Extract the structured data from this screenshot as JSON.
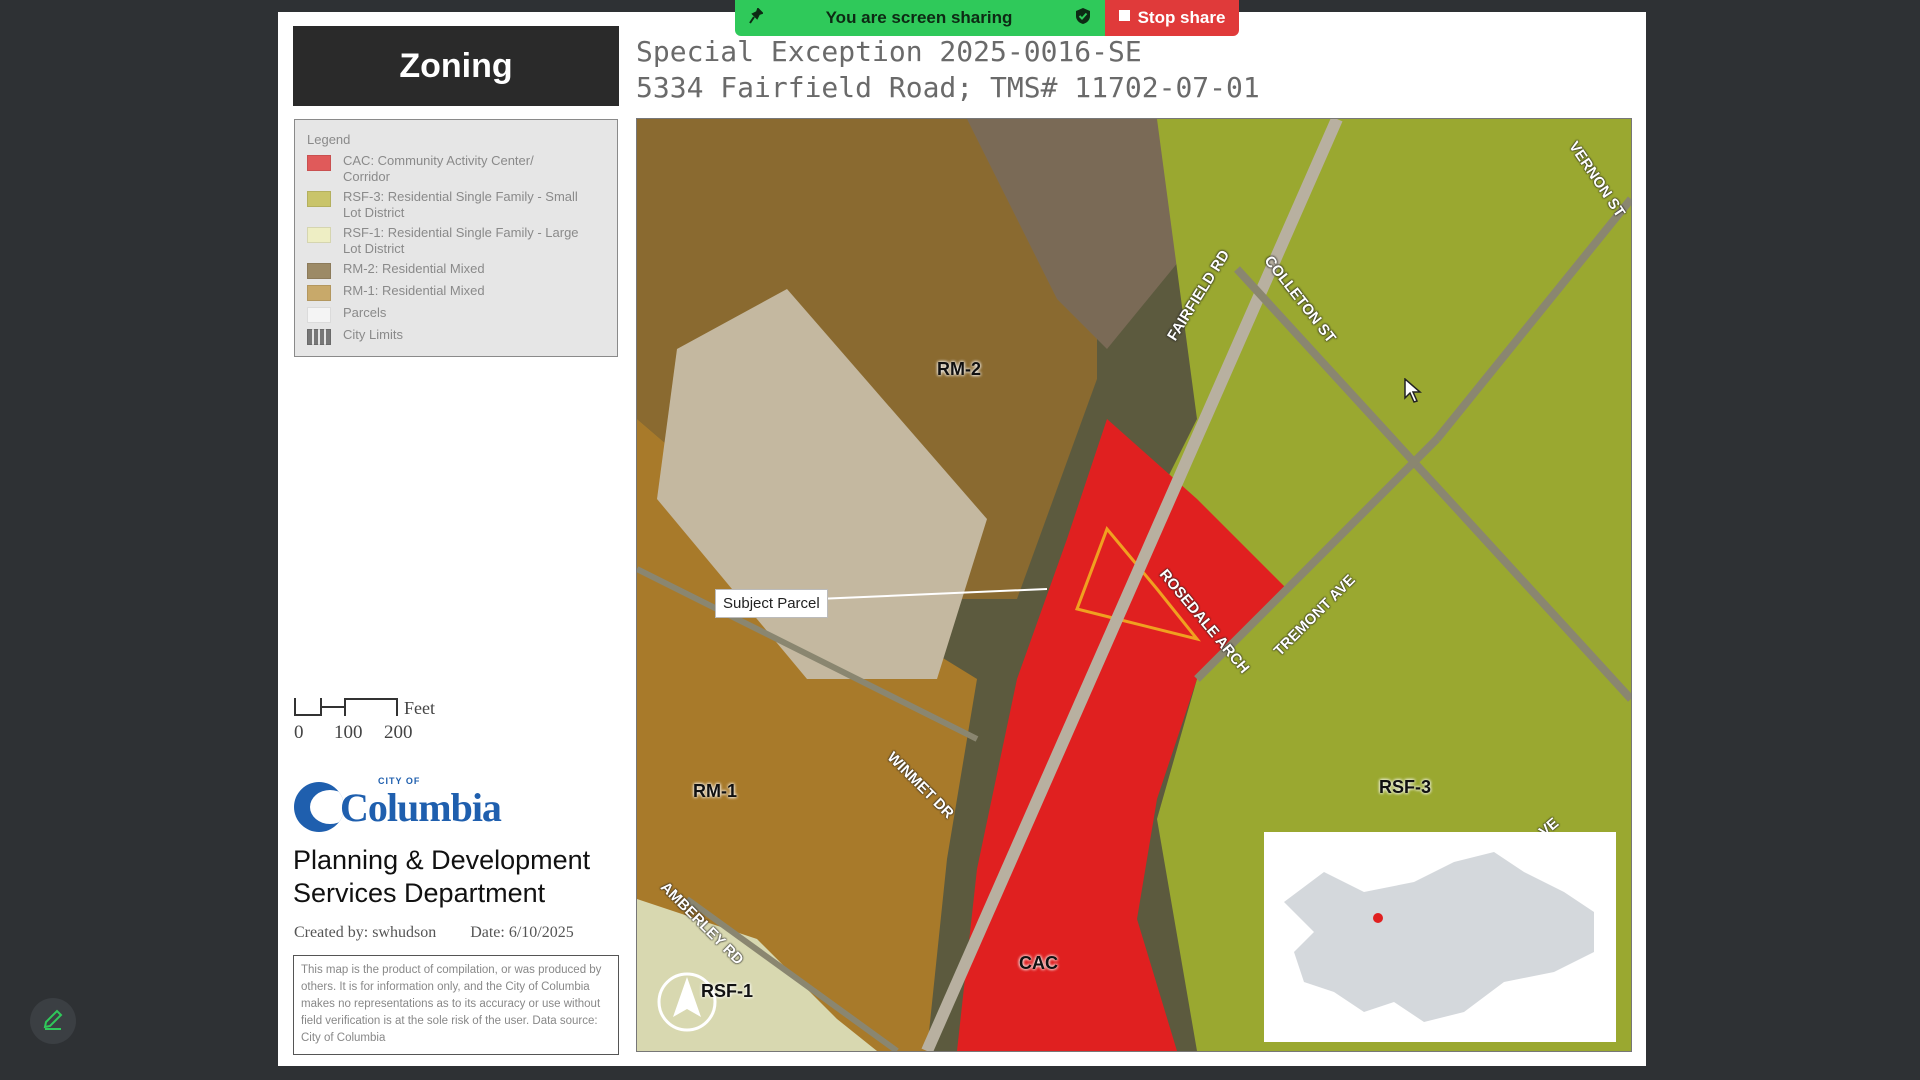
{
  "share_bar": {
    "status": "You are screen sharing",
    "stop_label": "Stop share",
    "pin_icon": "pin-icon",
    "shield_icon": "shield-check-icon"
  },
  "map_header": {
    "heading": "Zoning",
    "title_line1": "Special Exception 2025-0016-SE",
    "title_line2": "5334 Fairfield Road; TMS# 11702-07-01"
  },
  "legend": {
    "title": "Legend",
    "items": [
      {
        "label": "CAC: Community Activity Center/ Corridor",
        "color": "#e05a5a"
      },
      {
        "label": "RSF-3: Residential Single Family - Small Lot District",
        "color": "#c9c46a"
      },
      {
        "label": "RSF-1: Residential Single Family - Large Lot District",
        "color": "#eeeec4"
      },
      {
        "label": "RM-2: Residential Mixed",
        "color": "#9c8a66"
      },
      {
        "label": "RM-1: Residential Mixed",
        "color": "#c8a96a"
      },
      {
        "label": "Parcels",
        "color": "#f4f4f4"
      },
      {
        "label": "City Limits",
        "color": "#777777"
      }
    ]
  },
  "scale": {
    "unit": "Feet",
    "ticks": [
      "0",
      "100",
      "200"
    ]
  },
  "branding": {
    "logo_small": "CITY OF",
    "logo_text": "Columbia",
    "dept_line1": "Planning & Development",
    "dept_line2": "Services Department",
    "created_by": "Created by: swhudson",
    "date": "Date: 6/10/2025",
    "disclaimer": "This map is the product of compilation, or was produced by others. It is for information only, and the City of Columbia makes no representations as to its accuracy or use without field verification is at the sole risk of the user. Data source: City of Columbia"
  },
  "map": {
    "callout": "Subject Parcel",
    "zones": {
      "rm2": "RM-2",
      "rm1": "RM-1",
      "rsf3": "RSF-3",
      "cac": "CAC",
      "rsf1": "RSF-1"
    },
    "streets": {
      "fairfield": "FAIRFIELD RD",
      "colleton": "COLLETON ST",
      "vernon": "VERNON ST",
      "rosedale": "ROSEDALE ARCH",
      "tremont": "TREMONT AVE",
      "winmet": "WINMET DR",
      "amberley": "AMBERLEY RD",
      "ave_partial": "VE"
    },
    "colors": {
      "cac": "#e02020",
      "rsf3": "#9aa830",
      "rm2": "#8a6a30",
      "rm1": "#a87a2a",
      "rsf1": "#d8d8b0",
      "subject_outline": "#f0a020"
    }
  }
}
